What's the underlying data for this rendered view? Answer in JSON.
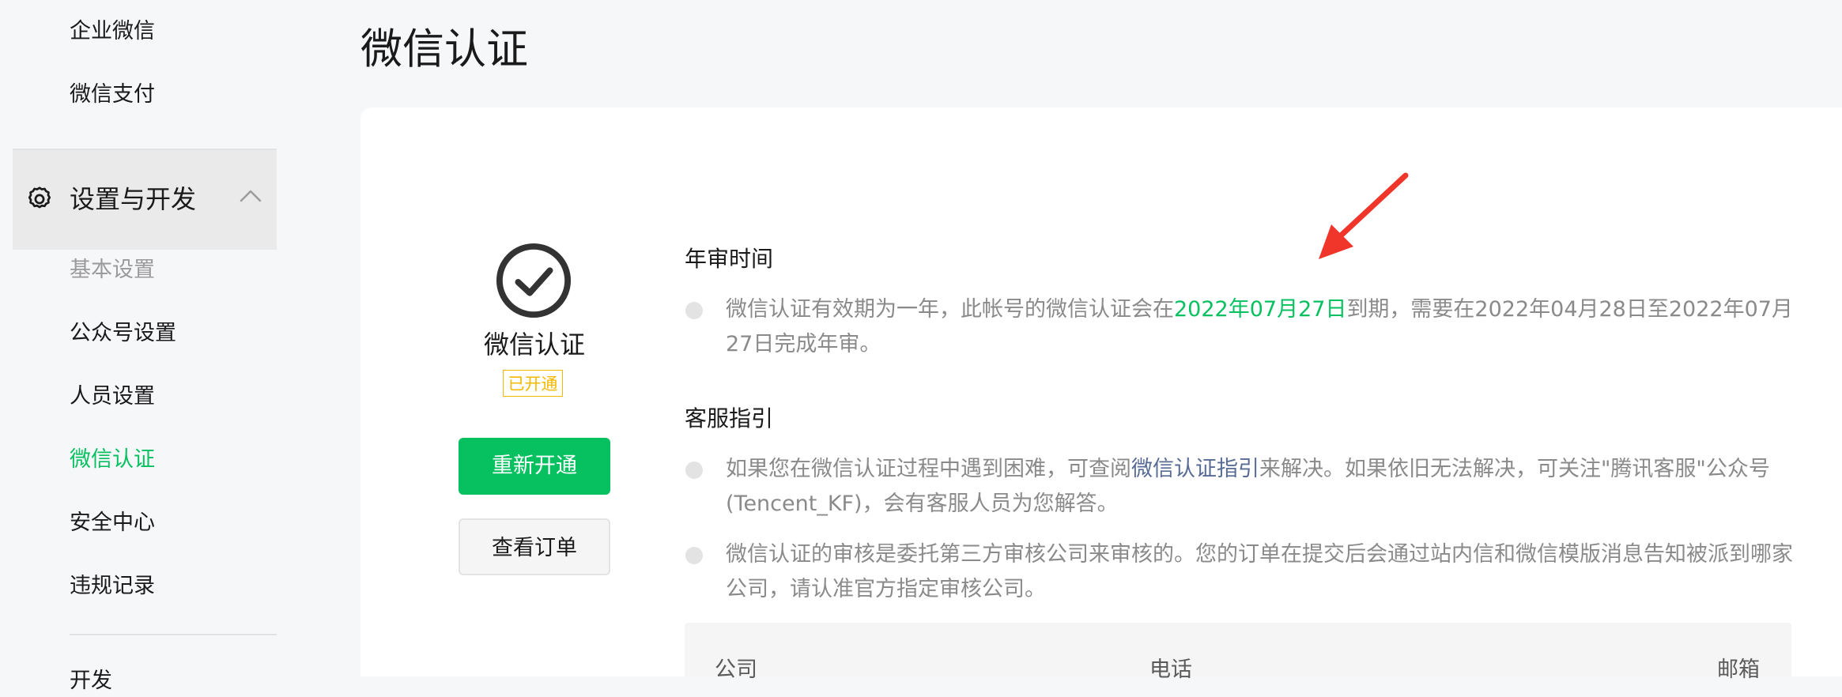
{
  "sidebar": {
    "top_items": [
      {
        "label": "企业微信"
      },
      {
        "label": "微信支付"
      }
    ],
    "group": {
      "label": "设置与开发",
      "icon": "gear-icon",
      "toggle_icon": "chevron-up-icon"
    },
    "sub_items": [
      {
        "label": "基本设置"
      },
      {
        "label": "公众号设置"
      },
      {
        "label": "人员设置"
      },
      {
        "label": "微信认证"
      },
      {
        "label": "安全中心"
      },
      {
        "label": "违规记录"
      }
    ],
    "next_item_partial": "开发"
  },
  "page_title": "微信认证",
  "certification": {
    "icon": "check-circle-icon",
    "name": "微信认证",
    "status": "已开通",
    "renew_button": "重新开通",
    "orders_button": "查看订单"
  },
  "annual_review": {
    "title": "年审时间",
    "text_before": "微信认证有效期为一年，此帐号的微信认证会在",
    "expiry_date": "2022年07月27日",
    "text_after": "到期，需要在2022年04月28日至2022年07月27日完成年审。"
  },
  "service_guide": {
    "title": "客服指引",
    "item1_before": "如果您在微信认证过程中遇到困难，可查阅",
    "item1_link": "微信认证指引",
    "item1_after": "来解决。如果依旧无法解决，可关注\"腾讯客服\"公众号(Tencent_KF)，会有客服人员为您解答。",
    "item2": "微信认证的审核是委托第三方审核公司来审核的。您的订单在提交后会通过站内信和微信模版消息告知被派到哪家公司，请认准官方指定审核公司。"
  },
  "company_table": {
    "columns": [
      "公司",
      "电话",
      "邮箱"
    ]
  },
  "annotation": {
    "icon": "red-arrow-icon"
  },
  "colors": {
    "accent_green": "#07c160",
    "link_blue": "#576b95",
    "status_yellow": "#f5b800",
    "arrow_red": "#f0352a",
    "page_bg": "#f6f7f9"
  }
}
